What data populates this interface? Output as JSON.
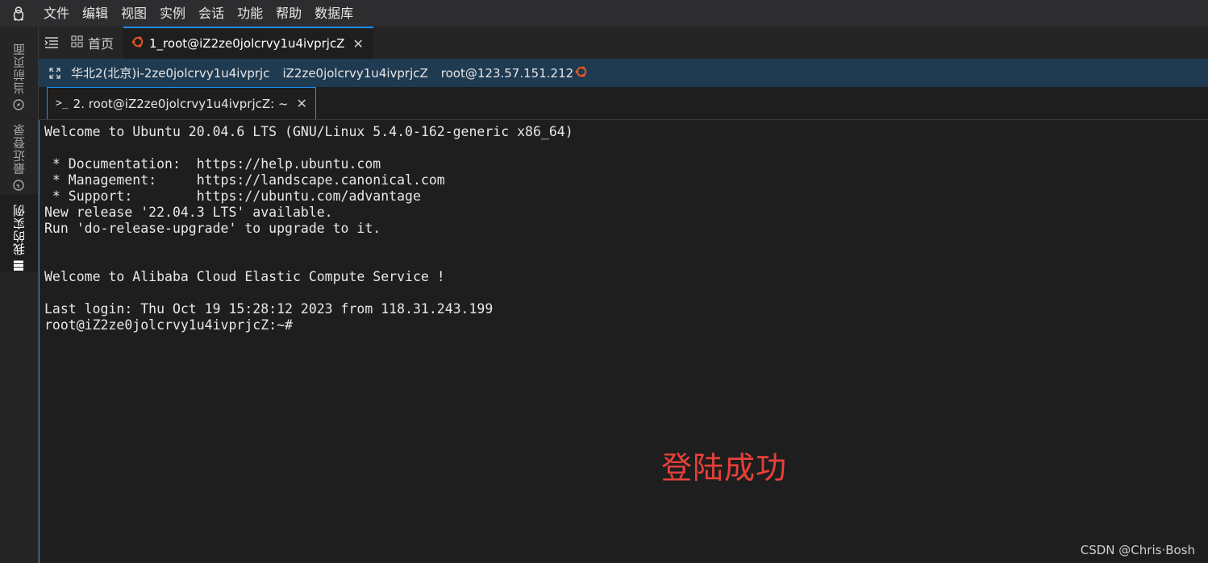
{
  "menubar": {
    "logo_icon": "linux-penguin-icon",
    "items": [
      "文件",
      "编辑",
      "视图",
      "实例",
      "会话",
      "功能",
      "帮助",
      "数据库"
    ]
  },
  "sidebar": {
    "items": [
      {
        "label": "当前页面",
        "icon": "compass-icon"
      },
      {
        "label": "最近登录",
        "icon": "clock-icon"
      },
      {
        "label": "我的实例",
        "icon": "server-stack-icon"
      }
    ]
  },
  "tabs": {
    "home_label": "首页",
    "session_label": "1_root@iZ2ze0jolcrvy1u4ivprjcZ"
  },
  "info": {
    "region": "华北2(北京)i-2ze0jolcrvy1u4ivprjc",
    "hostname": "iZ2ze0jolcrvy1u4ivprjcZ",
    "login": "root@123.57.151.212"
  },
  "terminal_tab": {
    "label": "2. root@iZ2ze0jolcrvy1u4ivprjcZ: ~"
  },
  "terminal": {
    "lines": [
      "Welcome to Ubuntu 20.04.6 LTS (GNU/Linux 5.4.0-162-generic x86_64)",
      "",
      " * Documentation:  https://help.ubuntu.com",
      " * Management:     https://landscape.canonical.com",
      " * Support:        https://ubuntu.com/advantage",
      "New release '22.04.3 LTS' available.",
      "Run 'do-release-upgrade' to upgrade to it.",
      "",
      "",
      "Welcome to Alibaba Cloud Elastic Compute Service !",
      "",
      "Last login: Thu Oct 19 15:28:12 2023 from 118.31.243.199",
      "root@iZ2ze0jolcrvy1u4ivprjcZ:~#"
    ]
  },
  "annotation": "登陆成功",
  "watermark": "CSDN @Chris·Bosh",
  "colors": {
    "accent": "#1e90ff",
    "annotation": "#e8403a",
    "ubuntu_orange": "#e95420"
  }
}
